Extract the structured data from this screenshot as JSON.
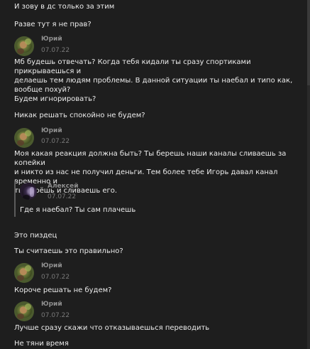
{
  "messages": {
    "m1": {
      "text": "И зову в дс только за этим"
    },
    "m2": {
      "text": "Разве тут я не прав?"
    },
    "m3": {
      "author": "Юрий",
      "time": "07.07.22",
      "lines": [
        "Мб будешь отвечать? Когда тебя кидали ты сразу спортиками прикрываешься и",
        "делаешь тем людям проблемы. В данной ситуации ты наебал и типо как,",
        "вообще похуй?"
      ]
    },
    "m4": {
      "text": "Будем игнорировать?"
    },
    "m5": {
      "text": "Никак решать спокойно не будем?"
    },
    "m6": {
      "author": "Юрий",
      "time": "07.07.22",
      "lines": [
        "Моя какая реакция должна быть? Ты берешь наши каналы сливаешь за копейки",
        "и никто из нас не получил деньги. Тем более тебе Игорь давал канал временно и",
        "ты берёшь и сливаешь его."
      ]
    },
    "quote": {
      "author": "Алексей",
      "time": "07.07.22",
      "text": "Где я наебал? Ты сам плачешь"
    },
    "m7": {
      "text": "Это пиздец"
    },
    "m8": {
      "text": "Ты считаешь это правильно?"
    },
    "m9": {
      "author": "Юрий",
      "time": "07.07.22",
      "text": "Короче решать не будем?"
    },
    "m10": {
      "author": "Юрий",
      "time": "07.07.22",
      "text": "Лучше сразу скажи что отказываешься переводить"
    },
    "m11": {
      "text": "Не тяни время"
    }
  }
}
